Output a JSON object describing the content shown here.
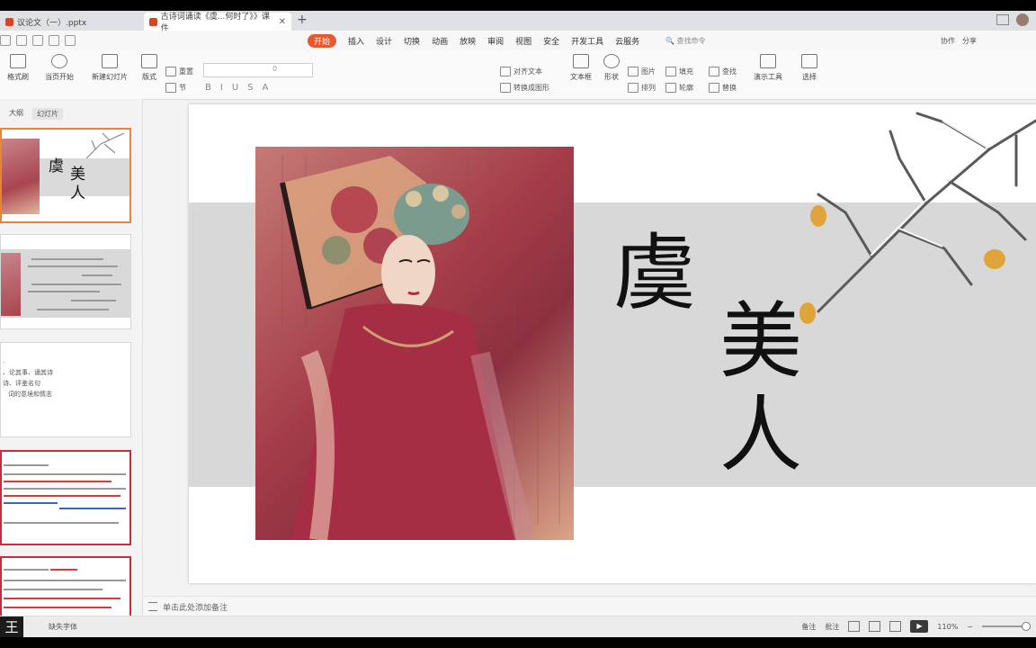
{
  "tabs": [
    {
      "label": "议论文（一）.pptx",
      "active": false
    },
    {
      "label": "古诗词诵读《虞...何时了》》课件",
      "active": true
    }
  ],
  "menu": [
    "开始",
    "插入",
    "设计",
    "切换",
    "动画",
    "放映",
    "审阅",
    "视图",
    "安全",
    "开发工具",
    "云服务"
  ],
  "search_command": "查找命令",
  "collab": {
    "collaborate": "协作",
    "share": "分享"
  },
  "ribbon": {
    "format_painter": "格式刷",
    "play_from_current": "当页开始",
    "new_slide": "新建幻灯片",
    "layout": "版式",
    "section": "节",
    "reset": "重置",
    "font_size": "0",
    "text_box": "文本框",
    "shape": "形状",
    "picture": "图片",
    "arrange": "排列",
    "find": "查找",
    "replace": "替换",
    "fill": "填充",
    "outline": "轮廓",
    "presentation_tools": "演示工具",
    "select": "选择",
    "align_text": "对齐文本",
    "to_smartart": "转换成图形"
  },
  "left_panel": {
    "tab_outline": "大纲",
    "tab_slides": "幻灯片",
    "thumb1": {
      "yu": "虞",
      "meiren": "美人"
    },
    "thumb3": {
      "lines": [
        "、论其事、诵其诗",
        "诗、评鉴名句",
        "词的意境和情志"
      ]
    }
  },
  "slide": {
    "title_char1": "虞",
    "title_char2": "美",
    "title_char3": "人"
  },
  "notes_placeholder": "单击此处添加备注",
  "status": {
    "ime_char": "王",
    "missing_fonts": "缺失字体",
    "notes": "备注",
    "comments": "批注",
    "zoom": "110%"
  }
}
